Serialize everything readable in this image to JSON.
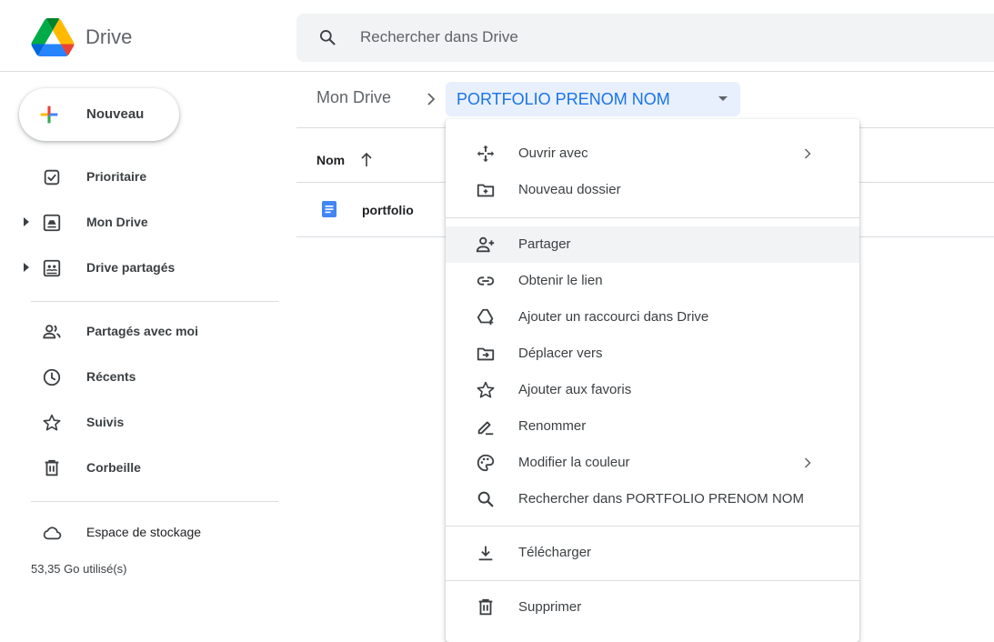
{
  "header": {
    "app_name": "Drive",
    "search_placeholder": "Rechercher dans Drive",
    "logo_colors": [
      "#0066da",
      "#00ac47",
      "#ea4335",
      "#00832d",
      "#2684fc",
      "#ffba00"
    ]
  },
  "sidebar": {
    "new_label": "Nouveau",
    "items": [
      {
        "label": "Prioritaire",
        "icon": "check-box-icon"
      },
      {
        "label": "Mon Drive",
        "icon": "my-drive-icon",
        "expandable": true
      },
      {
        "label": "Drive partagés",
        "icon": "shared-drives-icon",
        "expandable": true
      },
      {
        "label": "Partagés avec moi",
        "icon": "shared-with-me-icon"
      },
      {
        "label": "Récents",
        "icon": "clock-icon"
      },
      {
        "label": "Suivis",
        "icon": "star-icon"
      },
      {
        "label": "Corbeille",
        "icon": "trash-icon"
      },
      {
        "label": "Espace de stockage",
        "icon": "cloud-icon"
      }
    ],
    "storage_used": "53,35 Go utilisé(s)"
  },
  "breadcrumb": {
    "root": "Mon Drive",
    "current": "PORTFOLIO PRENOM NOM"
  },
  "list": {
    "column_name": "Nom",
    "files": [
      {
        "name": "portfolio",
        "icon": "google-docs-icon"
      }
    ]
  },
  "context_menu": {
    "items": [
      {
        "label": "Ouvrir avec",
        "icon": "open-with-icon",
        "submenu": true
      },
      {
        "label": "Nouveau dossier",
        "icon": "new-folder-icon"
      },
      {
        "label": "Partager",
        "icon": "person-add-icon",
        "hovered": true
      },
      {
        "label": "Obtenir le lien",
        "icon": "link-icon"
      },
      {
        "label": "Ajouter un raccourci dans Drive",
        "icon": "add-shortcut-icon"
      },
      {
        "label": "Déplacer vers",
        "icon": "move-to-icon"
      },
      {
        "label": "Ajouter aux favoris",
        "icon": "star-icon"
      },
      {
        "label": "Renommer",
        "icon": "rename-icon"
      },
      {
        "label": "Modifier la couleur",
        "icon": "palette-icon",
        "submenu": true
      },
      {
        "label": "Rechercher dans PORTFOLIO PRENOM NOM",
        "icon": "search-icon"
      },
      {
        "label": "Télécharger",
        "icon": "download-icon"
      },
      {
        "label": "Supprimer",
        "icon": "trash-icon"
      }
    ]
  },
  "colors": {
    "accent": "#1a73e8",
    "selected_bg": "#e8f0fe",
    "hover_bg": "#f1f3f4",
    "divider": "#dadce0",
    "text_secondary": "#5f6368"
  }
}
